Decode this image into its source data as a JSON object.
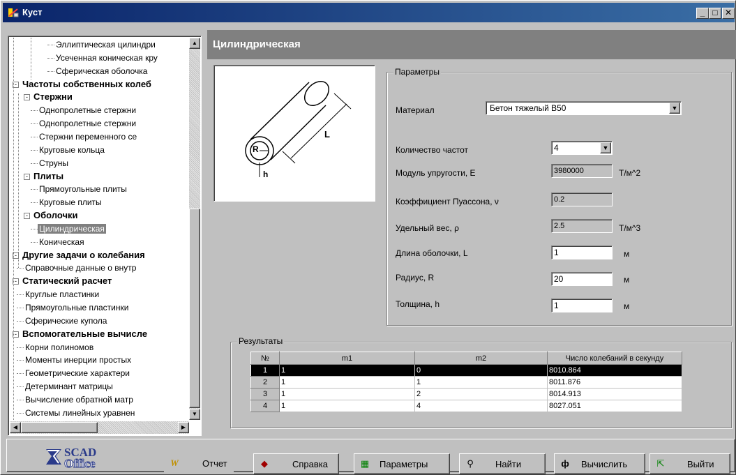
{
  "window": {
    "title": "Куст",
    "controls": [
      "_",
      "□",
      "X"
    ]
  },
  "tree": {
    "items": [
      {
        "label": "Эллиптическая цилиндри",
        "level": 3,
        "bold": false
      },
      {
        "label": "Усеченная коническая кру",
        "level": 3,
        "bold": false
      },
      {
        "label": "Сферическая оболочка",
        "level": 3,
        "bold": false
      },
      {
        "label": "Частоты собственных колеб",
        "level": 0,
        "bold": true,
        "expander": "-"
      },
      {
        "label": "Стержни",
        "level": 1,
        "bold": true,
        "expander": "-"
      },
      {
        "label": "Однопролетные стержни",
        "level": 2,
        "bold": false
      },
      {
        "label": "Однопролетные стержни",
        "level": 2,
        "bold": false
      },
      {
        "label": "Стержни переменного се",
        "level": 2,
        "bold": false
      },
      {
        "label": "Круговые кольца",
        "level": 2,
        "bold": false
      },
      {
        "label": "Струны",
        "level": 2,
        "bold": false
      },
      {
        "label": "Плиты",
        "level": 1,
        "bold": true,
        "expander": "-"
      },
      {
        "label": "Прямоугольные плиты",
        "level": 2,
        "bold": false
      },
      {
        "label": "Круговые плиты",
        "level": 2,
        "bold": false
      },
      {
        "label": "Оболочки",
        "level": 1,
        "bold": true,
        "expander": "-"
      },
      {
        "label": "Цилиндрическая",
        "level": 2,
        "bold": false,
        "selected": true
      },
      {
        "label": "Коническая",
        "level": 2,
        "bold": false
      },
      {
        "label": "Другие задачи о колебания",
        "level": 0,
        "bold": true,
        "expander": "-"
      },
      {
        "label": "Справочные данные о внутр",
        "level": 1,
        "bold": false
      },
      {
        "label": "Статический расчет",
        "level": 0,
        "bold": true,
        "expander": "-"
      },
      {
        "label": "Круглые пластинки",
        "level": 1,
        "bold": false
      },
      {
        "label": "Прямоугольные пластинки",
        "level": 1,
        "bold": false
      },
      {
        "label": "Сферические купола",
        "level": 1,
        "bold": false
      },
      {
        "label": "Вспомогательные вычисле",
        "level": 0,
        "bold": true,
        "expander": "-"
      },
      {
        "label": "Корни полиномов",
        "level": 1,
        "bold": false
      },
      {
        "label": "Моменты инерции простых",
        "level": 1,
        "bold": false
      },
      {
        "label": "Геометрические характери",
        "level": 1,
        "bold": false
      },
      {
        "label": "Детерминант матрицы",
        "level": 1,
        "bold": false
      },
      {
        "label": "Вычисление обратной матр",
        "level": 1,
        "bold": false
      },
      {
        "label": "Системы линейных уравнен",
        "level": 1,
        "bold": false
      }
    ]
  },
  "header": {
    "title": "Цилиндрическая"
  },
  "figure": {
    "label_L": "L",
    "label_R": "R",
    "label_h": "h"
  },
  "params": {
    "legend": "Параметры",
    "material_label": "Материал",
    "material_value": "Бетон тяжелый B50",
    "freq_count_label": "Количество частот",
    "freq_count_value": "4",
    "modulus_label": "Модуль упругости, E",
    "modulus_value": "3980000",
    "modulus_unit": "Т/м^2",
    "poisson_label": "Коэффициент Пуассона, ν",
    "poisson_value": "0.2",
    "weight_label": "Удельный вес, ρ",
    "weight_value": "2.5",
    "weight_unit": "Т/м^3",
    "length_label": "Длина оболочки, L",
    "length_value": "1",
    "length_unit": "м",
    "radius_label": "Радиус, R",
    "radius_value": "20",
    "radius_unit": "м",
    "thickness_label": "Толщина, h",
    "thickness_value": "1",
    "thickness_unit": "м"
  },
  "results": {
    "legend": "Результаты",
    "columns": [
      "№",
      "m1",
      "m2",
      "Число колебаний в секунду"
    ],
    "rows": [
      [
        "1",
        "1",
        "0",
        "8010.864"
      ],
      [
        "2",
        "1",
        "1",
        "8011.876"
      ],
      [
        "3",
        "1",
        "2",
        "8014.913"
      ],
      [
        "4",
        "1",
        "4",
        "8027.051"
      ]
    ]
  },
  "logo": {
    "line1": "SCAD",
    "line2": "Office"
  },
  "buttons": {
    "report": "Отчет",
    "help": "Справка",
    "params": "Параметры",
    "find": "Найти",
    "calc": "Вычислить",
    "exit": "Выйти"
  }
}
